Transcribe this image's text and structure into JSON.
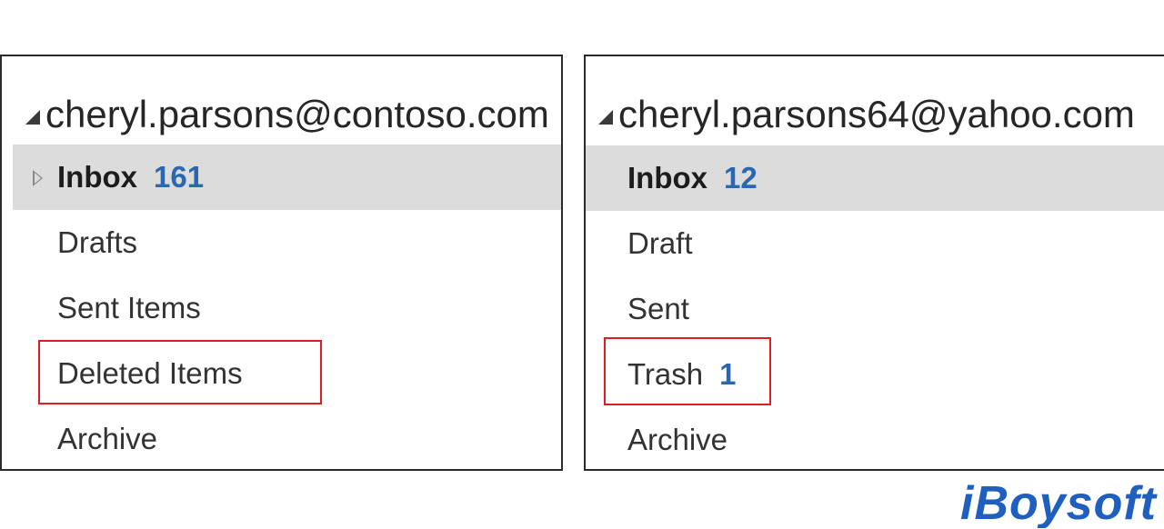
{
  "left_panel": {
    "account": "cheryl.parsons@contoso.com",
    "folders": [
      {
        "label": "Inbox",
        "count": "161"
      },
      {
        "label": "Drafts",
        "count": ""
      },
      {
        "label": "Sent Items",
        "count": ""
      },
      {
        "label": "Deleted Items",
        "count": ""
      },
      {
        "label": "Archive",
        "count": ""
      }
    ],
    "highlighted_folder": "Deleted Items"
  },
  "right_panel": {
    "account": "cheryl.parsons64@yahoo.com",
    "folders": [
      {
        "label": "Inbox",
        "count": "12"
      },
      {
        "label": "Draft",
        "count": ""
      },
      {
        "label": "Sent",
        "count": ""
      },
      {
        "label": "Trash",
        "count": "1"
      },
      {
        "label": "Archive",
        "count": ""
      }
    ],
    "highlighted_folder": "Trash"
  },
  "logo": {
    "text": "iBoysoft",
    "color": "#1f5fbf"
  },
  "colors": {
    "count_blue": "#2a67b1",
    "highlight_red": "#e01b24",
    "selected_row": "#dcdcdc"
  },
  "icons": {
    "account_collapse": "triangle-down-icon",
    "inbox_expand": "triangle-right-outline-icon"
  }
}
